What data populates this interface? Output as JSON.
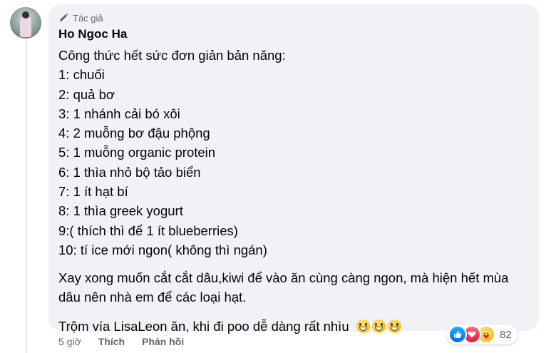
{
  "comment": {
    "badge_label": "Tác giả",
    "author": "Ho Ngoc Ha",
    "lines": [
      "Công thức hết sức đơn giản bản năng:",
      "1: chuối",
      "2: quả bơ",
      "3: 1 nhánh cải bó xôi",
      "4: 2 muỗng bơ đậu phộng",
      "5: 1 muỗng organic protein",
      "6: 1 thìa nhỏ bộ tảo biển",
      "7: 1 ít hạt bí",
      "8: 1 thìa greek yogurt",
      "9:( thích thì để 1 ít blueberries)",
      "10: tí ice mới ngon( không thì ngán)"
    ],
    "paragraph": "Xay xong muốn cắt cắt dâu,kiwi để vào ăn cùng càng ngon, mà hiện hết mùa dâu nên nhà em để các loại hạt.",
    "closing": "Trộm vía LisaLeon ăn, khi đi poo dễ dàng rất nhìu",
    "closing_emoji": [
      "grinning-face",
      "grinning-face",
      "grinning-face"
    ]
  },
  "actions": {
    "time": "5 giờ",
    "like": "Thích",
    "reply": "Phản hồi"
  },
  "reactions": {
    "types": [
      "like",
      "love",
      "care"
    ],
    "count": "82"
  },
  "colors": {
    "bubble": "#f0f2f5",
    "text": "#050505",
    "secondary": "#65676b",
    "like_blue": "#0866ff",
    "love_red": "#e61739"
  }
}
